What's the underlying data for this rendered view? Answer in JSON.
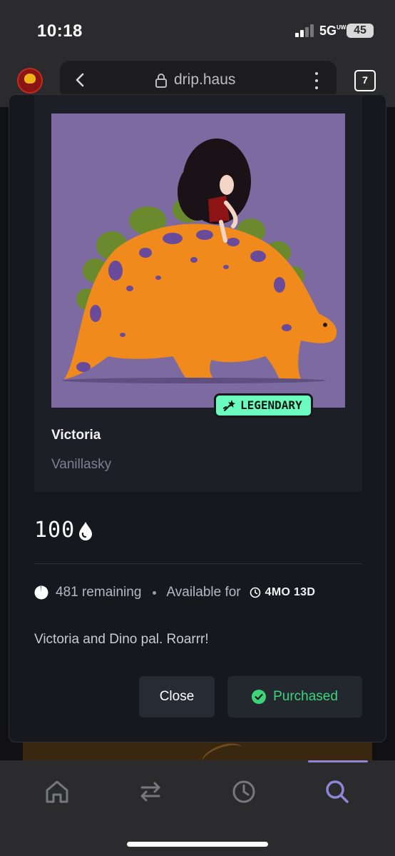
{
  "status_bar": {
    "time": "10:18",
    "network": "5G",
    "network_suffix": "UW",
    "battery": "45"
  },
  "browser": {
    "url": "drip.haus",
    "tab_count": "7"
  },
  "nft": {
    "rarity": "LEGENDARY",
    "title": "Victoria",
    "artist": "Vanillasky",
    "price": "100",
    "remaining": "481 remaining",
    "available_label": "Available for",
    "time_left": "4MO 13D",
    "description": "Victoria and Dino pal. Roarrr!"
  },
  "actions": {
    "close_label": "Close",
    "purchased_label": "Purchased"
  },
  "nav": {
    "items": [
      "home-icon",
      "swap-icon",
      "history-icon",
      "search-icon"
    ],
    "active": "search-icon"
  },
  "colors": {
    "accent_green": "#3fd37a",
    "legendary_badge": "#6dfcc0",
    "nav_active": "#8f86d8",
    "art_background": "#7c6aa0"
  }
}
